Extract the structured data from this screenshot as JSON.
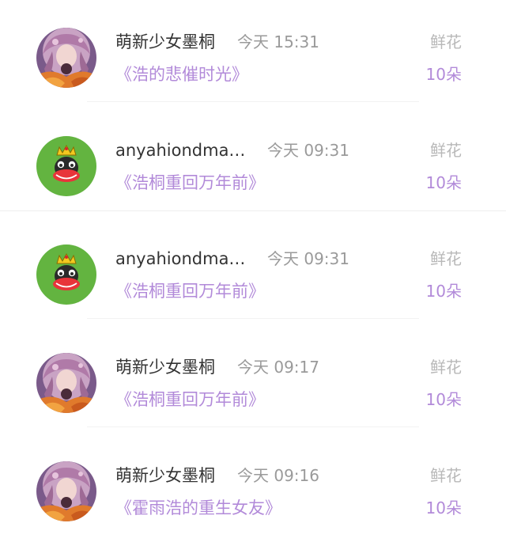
{
  "colors": {
    "name": "#333333",
    "time": "#9a9a9a",
    "book": "#b28ad9",
    "gift_type": "#b8b8b8",
    "gift_count": "#b28ad9",
    "monkey_bg": "#63b440"
  },
  "records": [
    {
      "avatar": "anime-girl-avatar",
      "name": "萌新少女墨桐",
      "time": "今天 15:31",
      "book": "《浩的悲催时光》",
      "gift_type": "鲜花",
      "gift_count": "10朵"
    },
    {
      "avatar": "crowned-monkey-avatar",
      "name": "anyahiondma…",
      "time": "今天 09:31",
      "book": "《浩桐重回万年前》",
      "gift_type": "鲜花",
      "gift_count": "10朵"
    },
    {
      "avatar": "crowned-monkey-avatar",
      "name": "anyahiondma…",
      "time": "今天 09:31",
      "book": "《浩桐重回万年前》",
      "gift_type": "鲜花",
      "gift_count": "10朵"
    },
    {
      "avatar": "anime-girl-avatar",
      "name": "萌新少女墨桐",
      "time": "今天 09:17",
      "book": "《浩桐重回万年前》",
      "gift_type": "鲜花",
      "gift_count": "10朵"
    },
    {
      "avatar": "anime-girl-avatar",
      "name": "萌新少女墨桐",
      "time": "今天 09:16",
      "book": "《霍雨浩的重生女友》",
      "gift_type": "鲜花",
      "gift_count": "10朵"
    }
  ]
}
